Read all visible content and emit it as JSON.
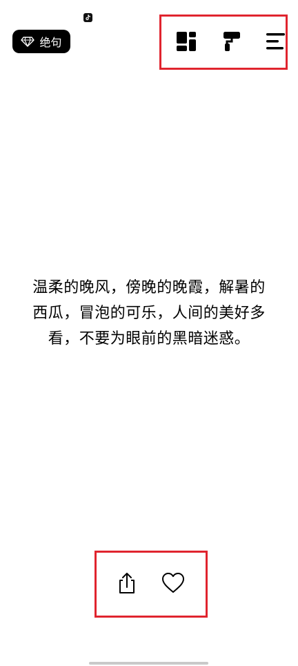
{
  "status_bar": {
    "notification_icon": "tiktok-icon"
  },
  "badge": {
    "icon": "diamond-icon",
    "label": "绝句"
  },
  "toolbar": {
    "items": [
      {
        "name": "layout-icon"
      },
      {
        "name": "paint-roller-icon"
      },
      {
        "name": "menu-icon"
      }
    ]
  },
  "content": {
    "quote": "温柔的晚风，傍晚的晚霞，解暑的西瓜，冒泡的可乐，人间的美好多看，不要为眼前的黑暗迷惑。"
  },
  "actions": {
    "items": [
      {
        "name": "share-icon"
      },
      {
        "name": "heart-icon"
      }
    ]
  },
  "colors": {
    "highlight_border": "#e0242e",
    "badge_bg": "#000000",
    "home_indicator": "#c9c9c9"
  }
}
